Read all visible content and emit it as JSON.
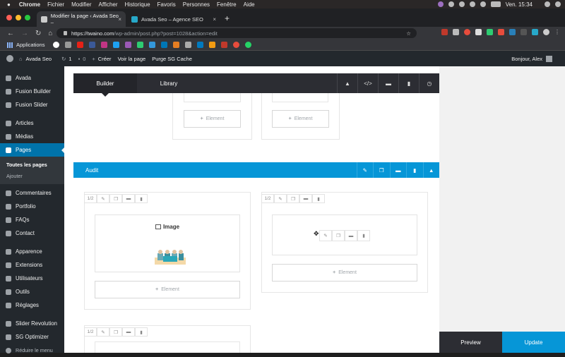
{
  "macos": {
    "app_name": "Chrome",
    "menu": [
      "Fichier",
      "Modifier",
      "Afficher",
      "Historique",
      "Favoris",
      "Personnes",
      "Fenêtre",
      "Aide"
    ],
    "clock": "Ven. 15:34"
  },
  "browser": {
    "tabs": [
      {
        "title": "Modifier la page ‹ Avada Seo –",
        "active": true
      },
      {
        "title": "Avada Seo – Agence SEO",
        "active": false
      }
    ],
    "new_tab": "+",
    "url_host": "https://twaino.com",
    "url_path": "/wp-admin/post.php?post=1028&action=edit",
    "bookmarks_apps": "Applications"
  },
  "wp_admin_bar": {
    "site_name": "Avada Seo",
    "updates": "1",
    "comments": "0",
    "new": "Créer",
    "view_page": "Voir la page",
    "purge": "Purge SG Cache",
    "greeting": "Bonjour, Alex"
  },
  "sidebar": {
    "group1": [
      {
        "label": "Avada",
        "icon": "avada-icon"
      },
      {
        "label": "Fusion Builder",
        "icon": "fusion-builder-icon"
      },
      {
        "label": "Fusion Slider",
        "icon": "fusion-slider-icon"
      }
    ],
    "group2": [
      {
        "label": "Articles",
        "icon": "pin-icon"
      },
      {
        "label": "Médias",
        "icon": "media-icon"
      },
      {
        "label": "Pages",
        "icon": "pages-icon",
        "active": true
      }
    ],
    "pages_sub": [
      "Toutes les pages",
      "Ajouter"
    ],
    "group3": [
      {
        "label": "Commentaires",
        "icon": "comment-icon"
      },
      {
        "label": "Portfolio",
        "icon": "portfolio-icon"
      },
      {
        "label": "FAQs",
        "icon": "faq-icon"
      },
      {
        "label": "Contact",
        "icon": "contact-icon"
      }
    ],
    "group4": [
      {
        "label": "Apparence",
        "icon": "brush-icon"
      },
      {
        "label": "Extensions",
        "icon": "plugin-icon"
      },
      {
        "label": "Utilisateurs",
        "icon": "users-icon"
      },
      {
        "label": "Outils",
        "icon": "tools-icon"
      },
      {
        "label": "Réglages",
        "icon": "settings-icon"
      }
    ],
    "group5": [
      {
        "label": "Slider Revolution",
        "icon": "slider-revolution-icon"
      },
      {
        "label": "SG Optimizer",
        "icon": "sg-optimizer-icon"
      },
      {
        "label": "Réduire le menu",
        "icon": "collapse-icon"
      }
    ]
  },
  "builder": {
    "tab_builder": "Builder",
    "tab_library": "Library",
    "tool_icons": [
      "collapse-icon",
      "code-icon",
      "save-icon",
      "trash-icon",
      "history-icon"
    ],
    "element_label": "Element",
    "section_title": "Audit",
    "section_tools": [
      "edit-icon",
      "clone-icon",
      "save-icon",
      "delete-icon",
      "toggle-icon"
    ],
    "column_size": "1/2",
    "image_element_label": "Image",
    "preview": "Preview",
    "update": "Update"
  },
  "colors": {
    "wp_dark": "#23282d",
    "wp_blue": "#0073aa",
    "fusion_blue": "#0696d7",
    "builder_dark": "#2c2d33"
  }
}
